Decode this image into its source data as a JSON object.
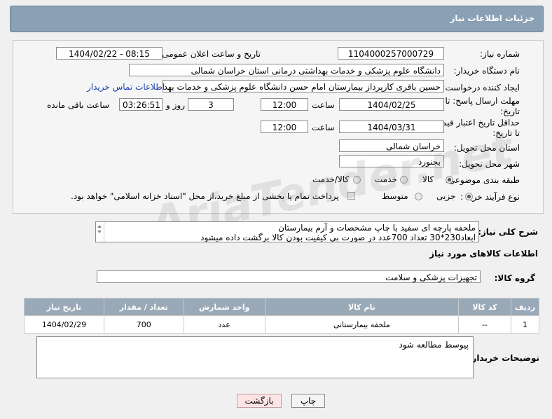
{
  "header": {
    "title": "جزئیات اطلاعات نیاز"
  },
  "form": {
    "need_number_label": "شماره نیاز:",
    "need_number": "1104000257000729",
    "announce_label": "تاریخ و ساعت اعلان عمومی:",
    "announce_value": "1404/02/22 - 08:15",
    "buyer_label": "نام دستگاه خریدار:",
    "buyer_value": "دانشگاه علوم پزشکی و خدمات بهداشتی درمانی استان خراسان شمالی",
    "creator_label": "ایجاد کننده درخواست:",
    "creator_value": "حسین باقری کارپرداز بیمارستان امام حسن دانشگاه علوم پزشکی و خدمات بهد",
    "contact_link": "اطلاعات تماس خریدار",
    "deadline_label": "مهلت ارسال پاسخ: تا تاریخ:",
    "deadline_date": "1404/02/25",
    "time_label": "ساعت",
    "deadline_time": "12:00",
    "days_value": "3",
    "days_label": "روز و",
    "remaining_time": "03:26:51",
    "remaining_label": "ساعت باقی مانده",
    "validity_label": "حداقل تاریخ اعتبار قیمت: تا تاریخ:",
    "validity_date": "1404/03/31",
    "validity_time": "12:00",
    "province_label": "استان محل تحویل:",
    "province_value": "خراسان شمالی",
    "city_label": "شهر محل تحویل:",
    "city_value": "بجنورد",
    "category_label": "طبقه بندی موضوعی:",
    "category_options": [
      "کالا",
      "خدمت",
      "کالا/خدمت"
    ],
    "process_label": "نوع فرآیند خرید :",
    "process_options": [
      "جزیی",
      "متوسط"
    ],
    "payment_note": "پرداخت تمام یا بخشی از مبلغ خرید،از محل \"اسناد خزانه اسلامی\" خواهد بود."
  },
  "description": {
    "label": "شرح کلی نیاز:",
    "line1": "ملحفه پارچه ای سفید با چاپ مشخصات و آرم بیمارستان",
    "line2": "ابعاد230*30   تعداد 700عدد در صورت بی کیفیت بودن کالا برگشت داده میشود"
  },
  "goods": {
    "section_title": "اطلاعات کالاهای مورد نیاز",
    "group_label": "گروه کالا:",
    "group_value": "تجهیزات پزشکی و سلامت",
    "columns": [
      "ردیف",
      "کد کالا",
      "نام کالا",
      "واحد شمارش",
      "تعداد / مقدار",
      "تاریخ نیاز"
    ],
    "rows": [
      {
        "row": "1",
        "code": "--",
        "name": "ملحفه بیمارستانی",
        "unit": "عدد",
        "qty": "700",
        "date": "1404/02/29"
      }
    ]
  },
  "notes": {
    "label": "توضیحات خریدار:",
    "value": "پیوسط مطالعه شود"
  },
  "buttons": {
    "print": "چاپ",
    "back": "بازگشت"
  },
  "watermark": "AriaTender.net"
}
